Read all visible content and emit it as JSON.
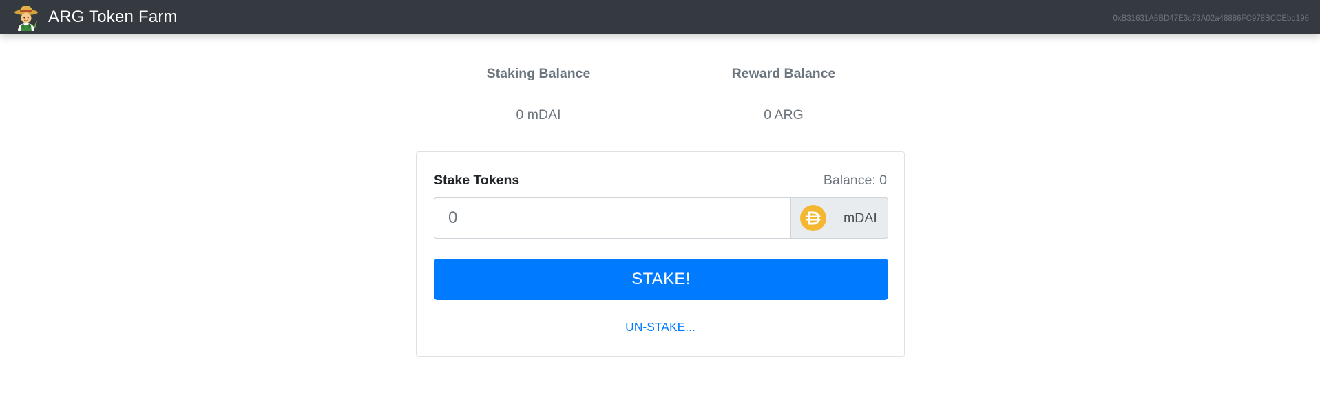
{
  "navbar": {
    "title": "ARG Token Farm",
    "logo_icon": "farmer-emoji-icon",
    "account_address": "0xB31631A6BD47E3c73A02a48886FC978BCCEbd196"
  },
  "balances": {
    "staking": {
      "label": "Staking Balance",
      "value": "0 mDAI"
    },
    "reward": {
      "label": "Reward Balance",
      "value": "0 ARG"
    }
  },
  "stake_card": {
    "title": "Stake Tokens",
    "balance_text": "Balance: 0",
    "amount_input": {
      "value": "",
      "placeholder": "0"
    },
    "token": {
      "icon": "dai-icon",
      "name": "mDAI",
      "icon_color": "#F4B731"
    },
    "stake_button_label": "STAKE!",
    "unstake_label": "UN-STAKE..."
  },
  "colors": {
    "navbar_bg": "#343a40",
    "primary": "#007bff",
    "muted": "#6c757d"
  }
}
